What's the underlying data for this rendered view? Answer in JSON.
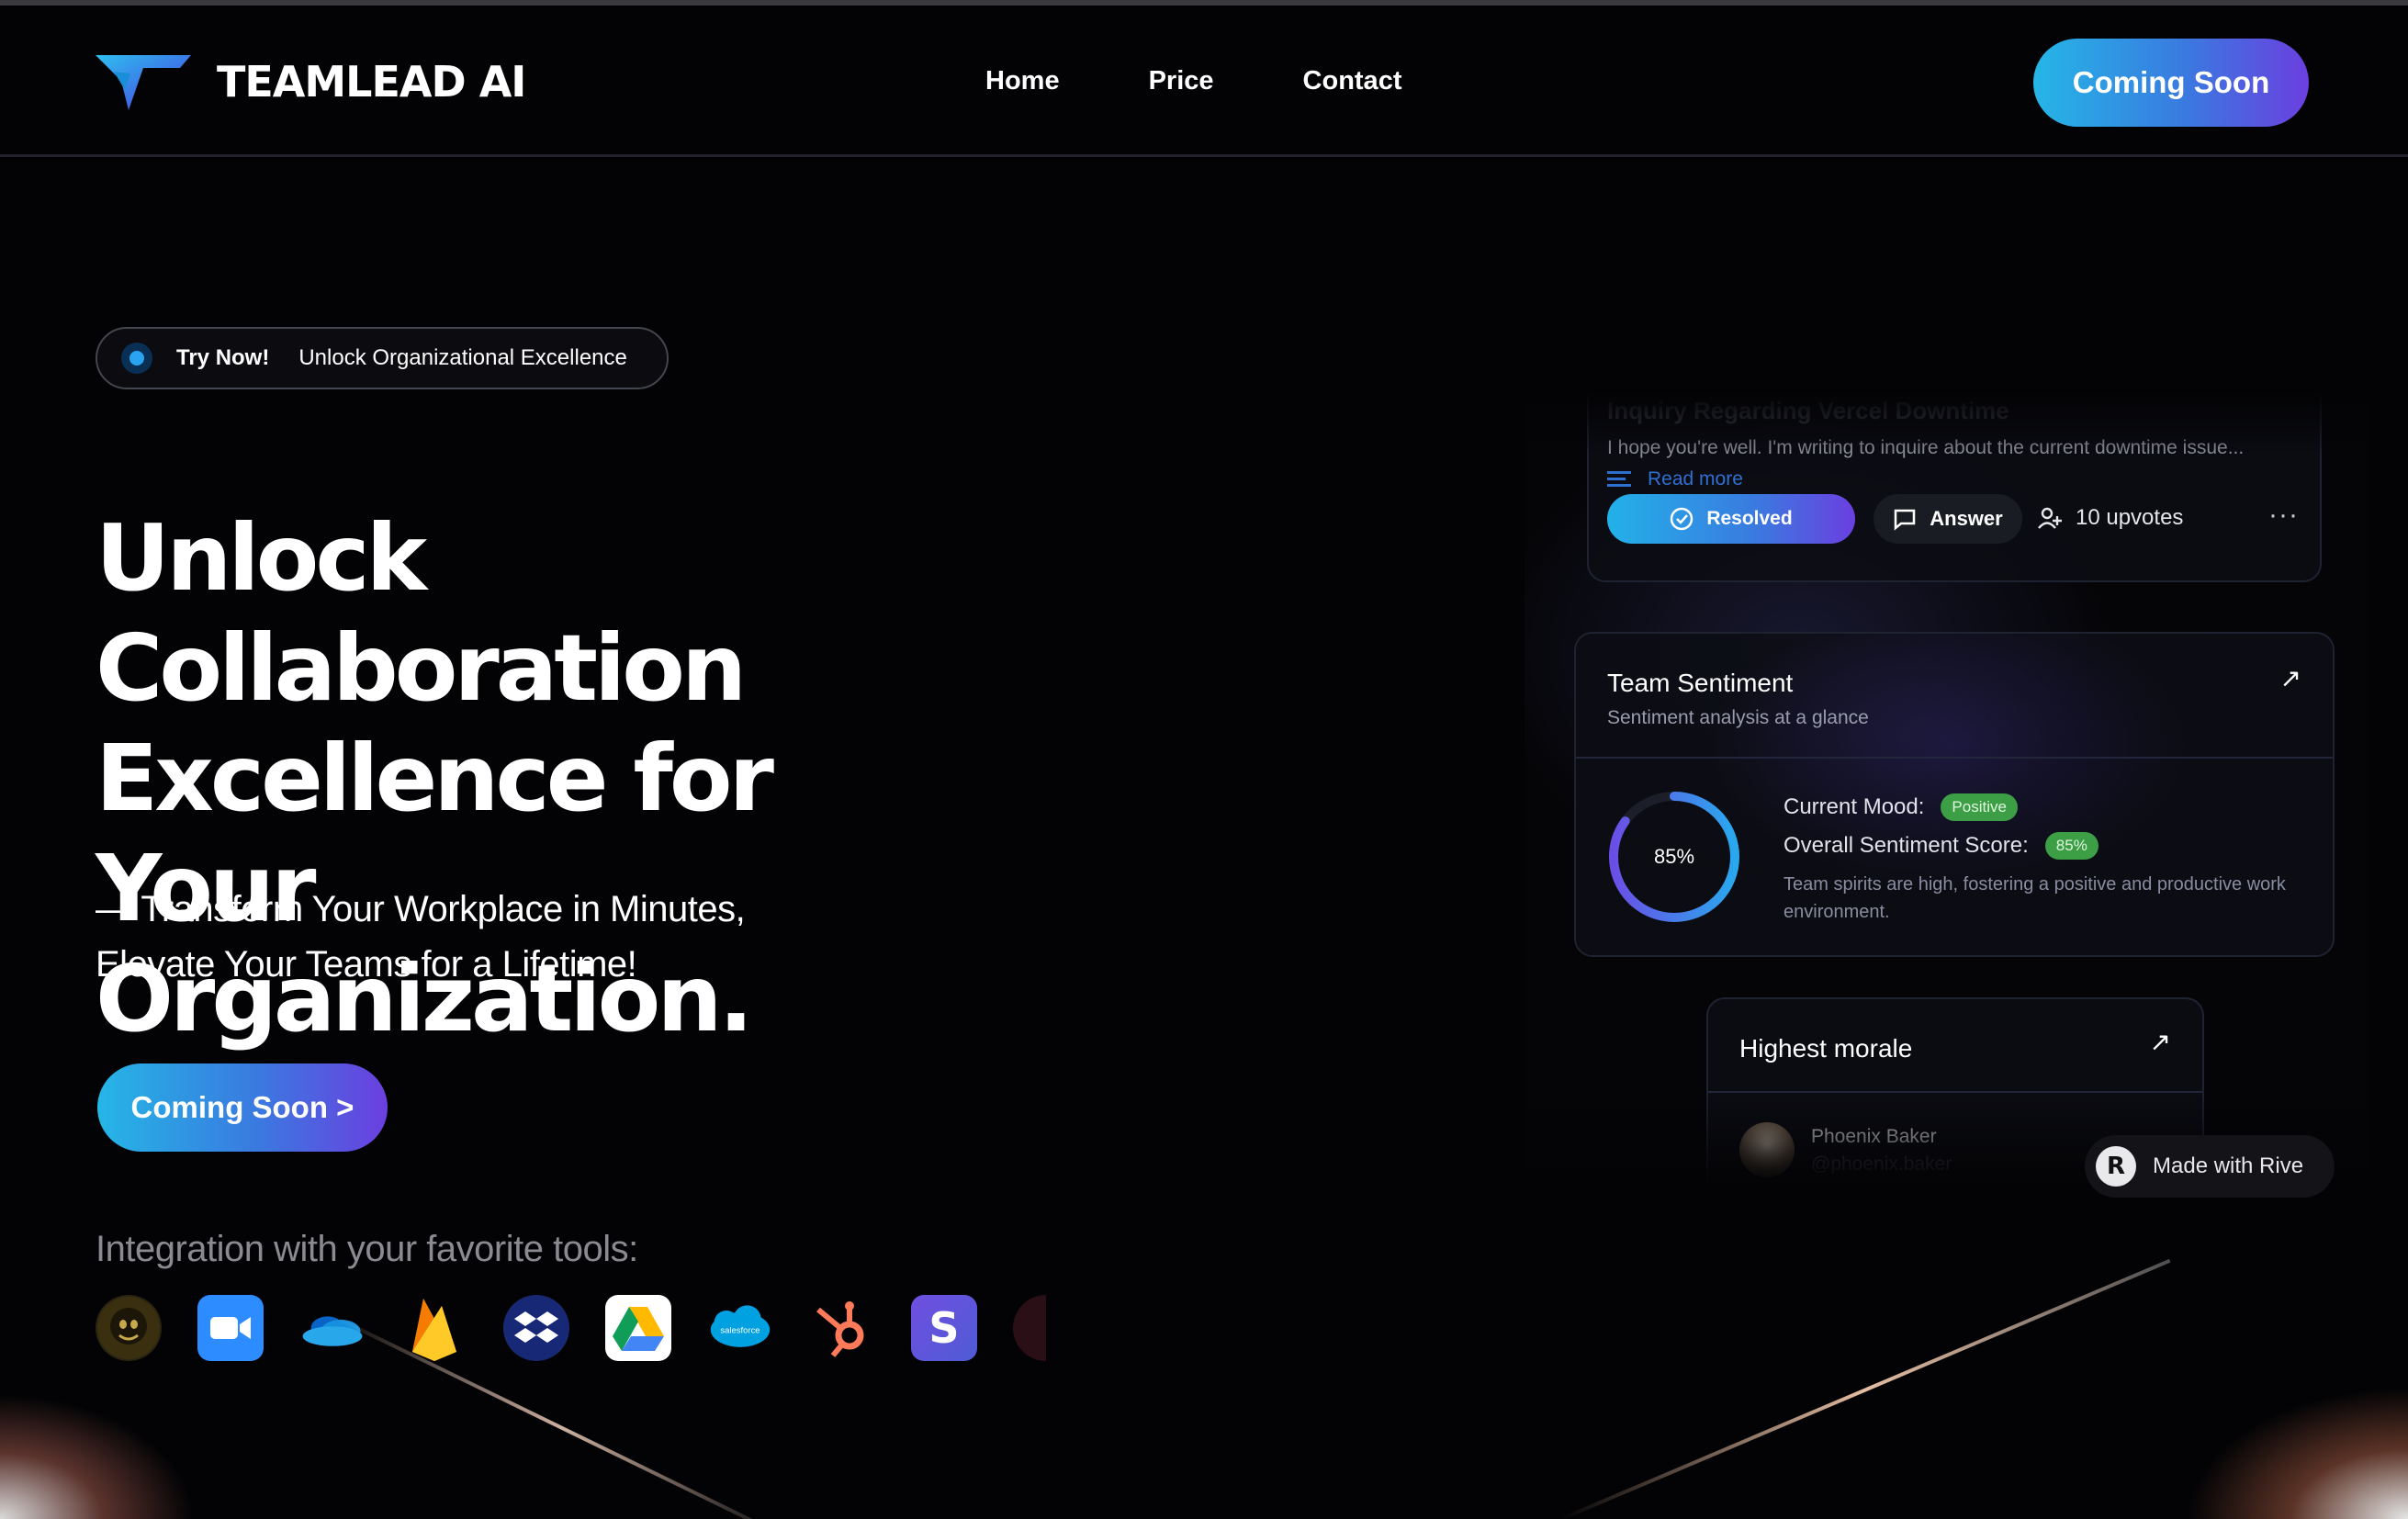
{
  "brand": {
    "name": "TEAMLEAD AI",
    "logo_icon": "teamlead-logo"
  },
  "nav": {
    "items": [
      {
        "label": "Home"
      },
      {
        "label": "Price"
      },
      {
        "label": "Contact"
      }
    ],
    "cta_label": "Coming Soon"
  },
  "hero": {
    "pill": {
      "try": "Try Now!",
      "text": "Unlock Organizational Excellence"
    },
    "title_lines": [
      "Unlock Collaboration",
      "Excellence for Your",
      "Organization."
    ],
    "subtitle_lines": [
      "— Transform Your Workplace in Minutes,",
      "Elevate Your Teams for a Lifetime!"
    ],
    "cta_label": "Coming Soon >",
    "integrations_label": "Integration with your favorite tools:",
    "tools": [
      "mailchimp-icon",
      "zoom-icon",
      "onedrive-icon",
      "firebase-icon",
      "dropbox-icon",
      "google-drive-icon",
      "salesforce-icon",
      "hubspot-icon",
      "stripe-icon",
      "partial-icon"
    ]
  },
  "inquiry_card": {
    "title": "Inquiry Regarding Vercel Downtime",
    "preview": "I hope you're well. I'm writing to inquire about the current downtime issue...",
    "read_more": "Read more",
    "resolved_label": "Resolved",
    "answer_label": "Answer",
    "upvotes": "10 upvotes",
    "more": "···"
  },
  "sentiment_card": {
    "title": "Team Sentiment",
    "subtitle": "Sentiment analysis at a glance",
    "percent": "85%",
    "percent_value": 0.85,
    "mood_label": "Current Mood:",
    "mood_badge": "Positive",
    "score_label": "Overall Sentiment Score:",
    "score_badge": "85%",
    "description": "Team spirits are high, fostering a positive and productive work environment."
  },
  "morale_card": {
    "title": "Highest morale",
    "person_name": "Phoenix Baker",
    "person_handle": "@phoenix.baker"
  },
  "rive_badge": {
    "label": "Made with Rive",
    "icon": "R"
  },
  "colors": {
    "accent_start": "#25b6e6",
    "accent_end": "#6b3fe0",
    "badge_green": "#3c9e45"
  }
}
